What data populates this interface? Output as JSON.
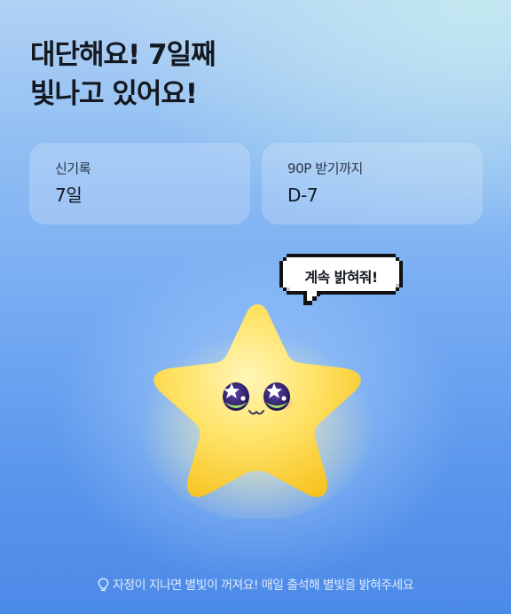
{
  "headline": {
    "line1": "대단해요! 7일째",
    "line2": "빛나고 있어요!"
  },
  "stats": {
    "record_label": "신기록",
    "record_value": "7일",
    "reward_label": "90P 받기까지",
    "reward_value": "D-7"
  },
  "bubble": {
    "text": "계속 밝혀줘!"
  },
  "mascot": {
    "icon": "star-character",
    "color": "#ffd83a"
  },
  "footer": {
    "icon": "lightbulb-icon",
    "text": "자정이 지나면 별빛이 꺼져요! 매일 출석해 별빛을 밝혀주세요"
  },
  "colors": {
    "text_primary": "#141820",
    "footer_text": "#dde9fb",
    "star_yellow": "#ffd83a"
  }
}
